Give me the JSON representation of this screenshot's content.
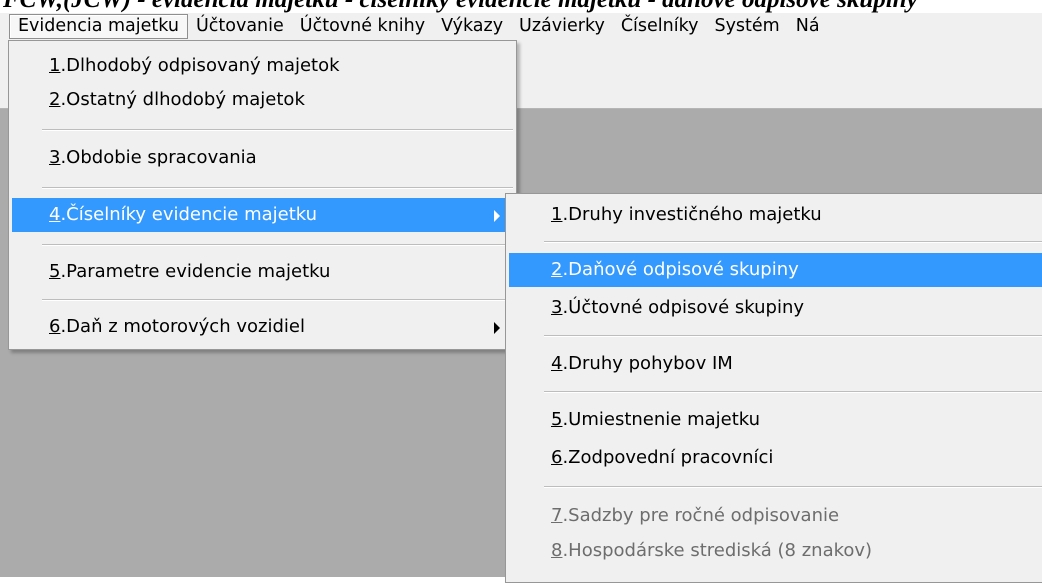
{
  "title_strip": "FCW,(JCW) - evidencia majetku - číselníky evidencie majetku - daňové odpisové skupiny",
  "menubar": [
    {
      "label": "Evidencia majetku",
      "active": true
    },
    {
      "label": "Účtovanie"
    },
    {
      "label": "Účtovné knihy"
    },
    {
      "label": "Výkazy"
    },
    {
      "label": "Uzávierky"
    },
    {
      "label": "Číselníky"
    },
    {
      "label": "Systém"
    },
    {
      "label": "Ná"
    }
  ],
  "main_menu": [
    {
      "key": "1",
      "text": ".Dlhodobý odpisovaný majetok"
    },
    {
      "key": "2",
      "text": ".Ostatný dlhodobý majetok"
    },
    {
      "key": "3",
      "text": ".Obdobie spracovania"
    },
    {
      "key": "4",
      "text": ".Číselníky evidencie majetku",
      "submenu": true,
      "highlight": true
    },
    {
      "key": "5",
      "text": ".Parametre evidencie majetku"
    },
    {
      "key": "6",
      "text": ".Daň z motorových vozidiel",
      "submenu": true
    }
  ],
  "sub_menu": [
    {
      "key": "1",
      "text": ".Druhy investičného majetku"
    },
    {
      "key": "2",
      "text": ".Daňové odpisové skupiny",
      "highlight": true
    },
    {
      "key": "3",
      "text": ".Účtovné odpisové skupiny"
    },
    {
      "key": "4",
      "text": ".Druhy pohybov IM"
    },
    {
      "key": "5",
      "text": ".Umiestnenie majetku"
    },
    {
      "key": "6",
      "text": ".Zodpovední pracovníci"
    },
    {
      "key": "7",
      "text": ".Sadzby pre ročné odpisovanie",
      "disabled": true
    },
    {
      "key": "8",
      "text": ".Hospodárske strediská (8 znakov)",
      "disabled": true
    }
  ],
  "colors": {
    "highlight": "#3399ff",
    "workspace": "#ababab",
    "menu_bg": "#f0f0f0"
  }
}
